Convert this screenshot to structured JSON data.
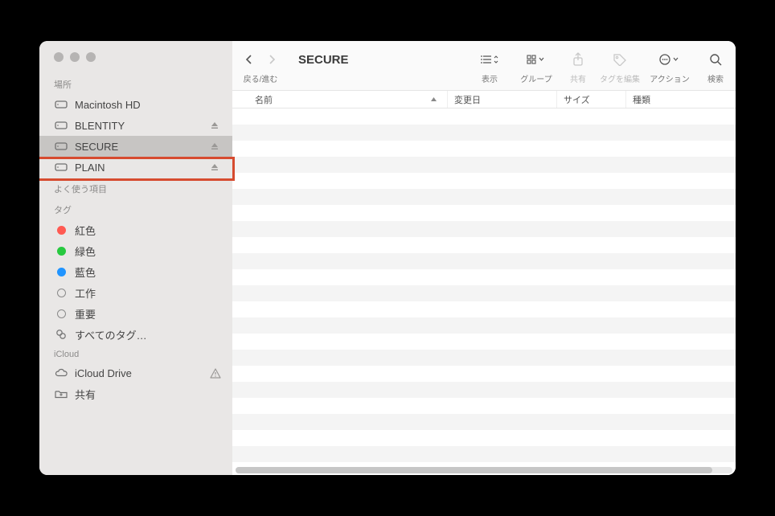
{
  "window": {
    "title": "SECURE"
  },
  "toolbar": {
    "back_forward_label": "戻る/進む",
    "view_label": "表示",
    "group_label": "グループ",
    "share_label": "共有",
    "edit_tags_label": "タグを編集",
    "action_label": "アクション",
    "search_label": "検索"
  },
  "columns": {
    "name": "名前",
    "date_modified": "変更日",
    "size": "サイズ",
    "kind": "種類"
  },
  "sidebar": {
    "locations_label": "場所",
    "locations": [
      {
        "label": "Macintosh HD",
        "ejectable": false
      },
      {
        "label": "BLENTITY",
        "ejectable": true
      },
      {
        "label": "SECURE",
        "ejectable": true,
        "selected": true
      },
      {
        "label": "PLAIN",
        "ejectable": true
      }
    ],
    "favorites_label": "よく使う項目",
    "tags_label": "タグ",
    "tags": [
      {
        "label": "紅色",
        "color": "#ff5a52"
      },
      {
        "label": "緑色",
        "color": "#27c93f"
      },
      {
        "label": "藍色",
        "color": "#1f"
      },
      {
        "label": "工作",
        "hollow": true
      },
      {
        "label": "重要",
        "hollow": true
      }
    ],
    "all_tags_label": "すべてのタグ…",
    "icloud_label": "iCloud",
    "icloud_items": [
      {
        "label": "iCloud Drive",
        "warn": true
      },
      {
        "label": "共有"
      }
    ]
  }
}
